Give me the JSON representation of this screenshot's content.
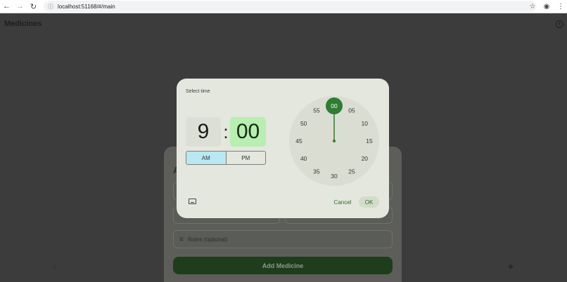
{
  "browser": {
    "url": "localhost:51168/#/main"
  },
  "app": {
    "title": "Medicines",
    "sheet_heading_initial": "A",
    "notes_placeholder": "Notes (optional)",
    "add_button_label": "Add Medicine"
  },
  "dialog": {
    "title": "Select time",
    "hour": "9",
    "separator": ":",
    "minute": "00",
    "am_label": "AM",
    "pm_label": "PM",
    "selected_period": "AM",
    "cancel_label": "Cancel",
    "ok_label": "OK",
    "selected_minute": "00",
    "dial_labels": [
      "00",
      "05",
      "10",
      "15",
      "20",
      "25",
      "30",
      "35",
      "40",
      "45",
      "50",
      "55"
    ]
  },
  "colors": {
    "dialog_bg": "#e4e7dd",
    "selected_minute_bg": "#b8eeb1",
    "dial_accent": "#2e7d32",
    "am_selected_bg": "#b9e8f2",
    "action_text": "#2d6a2d"
  },
  "icons": {
    "back": "arrow-left-icon",
    "forward": "arrow-right-icon",
    "reload": "reload-icon",
    "site_info": "info-icon",
    "bookmark": "star-icon",
    "profile": "account-icon",
    "menu": "kebab-menu-icon",
    "keyboard": "keyboard-icon",
    "home": "home-icon",
    "person": "person-icon",
    "notes": "notes-lines-icon",
    "add": "add-circle-icon"
  }
}
